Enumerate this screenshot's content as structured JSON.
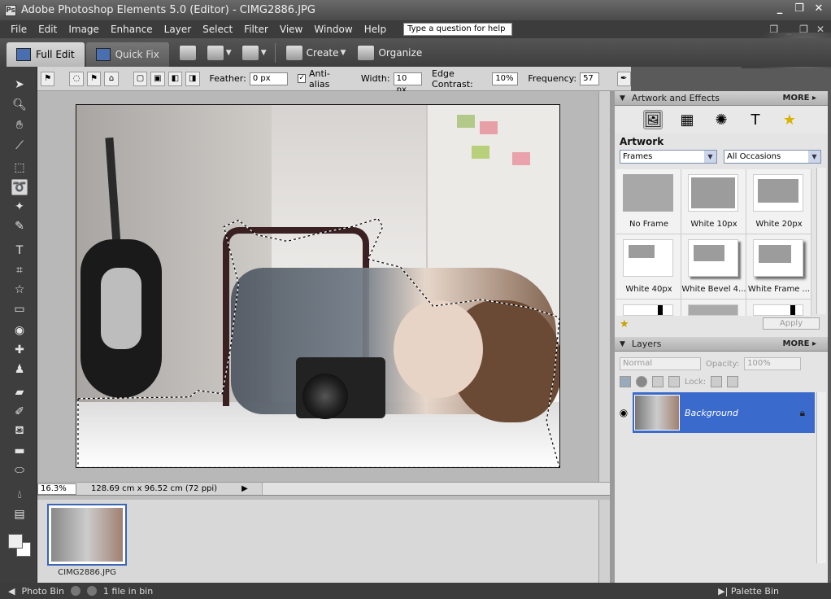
{
  "window": {
    "title": "Adobe Photoshop Elements 5.0 (Editor) - CIMG2886.JPG"
  },
  "menu": {
    "items": [
      "File",
      "Edit",
      "Image",
      "Enhance",
      "Layer",
      "Select",
      "Filter",
      "View",
      "Window",
      "Help"
    ],
    "help_placeholder": "Type a question for help"
  },
  "modebar": {
    "full_edit": "Full Edit",
    "quick_fix": "Quick Fix",
    "create": "Create",
    "organize": "Organize"
  },
  "options": {
    "feather_label": "Feather:",
    "feather_value": "0 px",
    "antialias_label": "Anti-alias",
    "width_label": "Width:",
    "width_value": "10 px",
    "edge_label": "Edge Contrast:",
    "edge_value": "10%",
    "freq_label": "Frequency:",
    "freq_value": "57"
  },
  "status": {
    "zoom": "16.3%",
    "dimensions": "128.69 cm x 96.52 cm (72 ppi)"
  },
  "bin": {
    "file_name": "CIMG2886.JPG",
    "label": "Photo Bin",
    "count": "1 file in bin",
    "palette_bin": "Palette Bin"
  },
  "artwork": {
    "panel_title": "Artwork and Effects",
    "more": "MORE",
    "heading": "Artwork",
    "category": "Frames",
    "occasion": "All Occasions",
    "frames": [
      {
        "name": "No Frame"
      },
      {
        "name": "White 10px"
      },
      {
        "name": "White 20px"
      },
      {
        "name": "White 40px"
      },
      {
        "name": "White Bevel 4..."
      },
      {
        "name": "White Frame ..."
      }
    ],
    "apply": "Apply"
  },
  "layers": {
    "panel_title": "Layers",
    "more": "MORE",
    "blend_mode": "Normal",
    "opacity_label": "Opacity:",
    "opacity_value": "100%",
    "lock_label": "Lock:",
    "layer_name": "Background"
  },
  "icons": {
    "tools": [
      "move-icon",
      "zoom-icon",
      "hand-icon",
      "eyedropper-icon",
      "marquee-icon",
      "magnetic-lasso-icon",
      "magic-wand-icon",
      "brush-select-icon",
      "type-icon",
      "crop-icon",
      "cookie-cutter-icon",
      "straighten-icon",
      "red-eye-icon",
      "healing-brush-icon",
      "clone-stamp-icon",
      "eraser-icon",
      "brush-icon",
      "paint-bucket-icon",
      "gradient-icon",
      "shape-icon",
      "blur-icon",
      "sponge-icon"
    ]
  }
}
